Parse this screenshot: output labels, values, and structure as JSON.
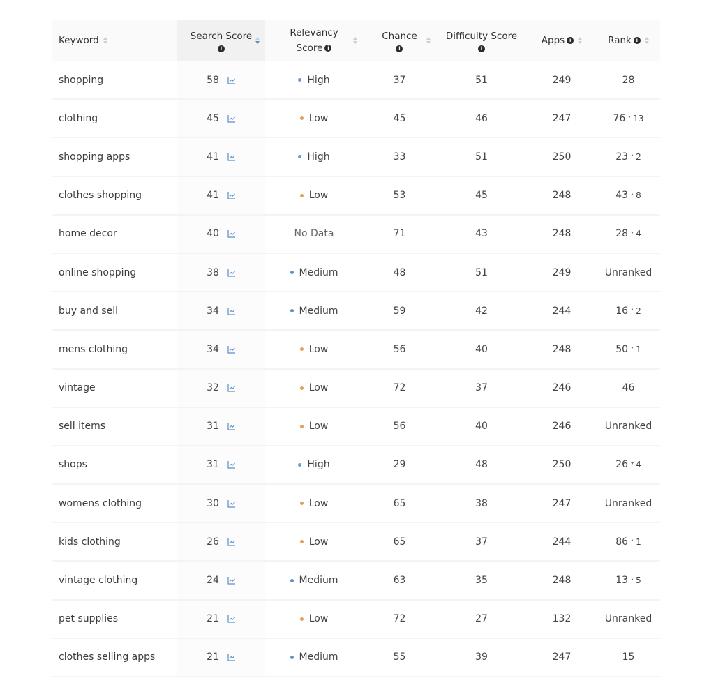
{
  "colors": {
    "high": "#6a9ccc",
    "medium": "#5b93c9",
    "low": "#e0a05a",
    "chart_icon": "#5b8fc4",
    "sort_active": "#5b8fc4"
  },
  "header": {
    "keyword": "Keyword",
    "search_score_line1": "Search Score",
    "relevancy_line1": "Relevancy",
    "relevancy_line2": "Score",
    "chance": "Chance",
    "difficulty": "Difficulty Score",
    "apps": "Apps",
    "rank": "Rank",
    "info_glyph": "i",
    "sorted_column": "Search Score",
    "sort_direction": "descending"
  },
  "rows": [
    {
      "keyword": "shopping",
      "search_score": "58",
      "relevancy": "High",
      "relevancy_level": "high",
      "chance": "37",
      "difficulty": "51",
      "apps": "249",
      "rank": "28",
      "rank_change": "",
      "rank_dir": ""
    },
    {
      "keyword": "clothing",
      "search_score": "45",
      "relevancy": "Low",
      "relevancy_level": "low",
      "chance": "45",
      "difficulty": "46",
      "apps": "247",
      "rank": "76",
      "rank_change": "13",
      "rank_dir": "down"
    },
    {
      "keyword": "shopping apps",
      "search_score": "41",
      "relevancy": "High",
      "relevancy_level": "high",
      "chance": "33",
      "difficulty": "51",
      "apps": "250",
      "rank": "23",
      "rank_change": "2",
      "rank_dir": "up"
    },
    {
      "keyword": "clothes shopping",
      "search_score": "41",
      "relevancy": "Low",
      "relevancy_level": "low",
      "chance": "53",
      "difficulty": "45",
      "apps": "248",
      "rank": "43",
      "rank_change": "8",
      "rank_dir": "up"
    },
    {
      "keyword": "home decor",
      "search_score": "40",
      "relevancy": "No Data",
      "relevancy_level": "none",
      "chance": "71",
      "difficulty": "43",
      "apps": "248",
      "rank": "28",
      "rank_change": "4",
      "rank_dir": "down"
    },
    {
      "keyword": "online shopping",
      "search_score": "38",
      "relevancy": "Medium",
      "relevancy_level": "medium",
      "chance": "48",
      "difficulty": "51",
      "apps": "249",
      "rank": "Unranked",
      "rank_change": "",
      "rank_dir": ""
    },
    {
      "keyword": "buy and sell",
      "search_score": "34",
      "relevancy": "Medium",
      "relevancy_level": "medium",
      "chance": "59",
      "difficulty": "42",
      "apps": "244",
      "rank": "16",
      "rank_change": "2",
      "rank_dir": "up"
    },
    {
      "keyword": "mens clothing",
      "search_score": "34",
      "relevancy": "Low",
      "relevancy_level": "low",
      "chance": "56",
      "difficulty": "40",
      "apps": "248",
      "rank": "50",
      "rank_change": "1",
      "rank_dir": "down"
    },
    {
      "keyword": "vintage",
      "search_score": "32",
      "relevancy": "Low",
      "relevancy_level": "low",
      "chance": "72",
      "difficulty": "37",
      "apps": "246",
      "rank": "46",
      "rank_change": "",
      "rank_dir": ""
    },
    {
      "keyword": "sell items",
      "search_score": "31",
      "relevancy": "Low",
      "relevancy_level": "low",
      "chance": "56",
      "difficulty": "40",
      "apps": "246",
      "rank": "Unranked",
      "rank_change": "",
      "rank_dir": ""
    },
    {
      "keyword": "shops",
      "search_score": "31",
      "relevancy": "High",
      "relevancy_level": "high",
      "chance": "29",
      "difficulty": "48",
      "apps": "250",
      "rank": "26",
      "rank_change": "4",
      "rank_dir": "down"
    },
    {
      "keyword": "womens clothing",
      "search_score": "30",
      "relevancy": "Low",
      "relevancy_level": "low",
      "chance": "65",
      "difficulty": "38",
      "apps": "247",
      "rank": "Unranked",
      "rank_change": "",
      "rank_dir": ""
    },
    {
      "keyword": "kids clothing",
      "search_score": "26",
      "relevancy": "Low",
      "relevancy_level": "low",
      "chance": "65",
      "difficulty": "37",
      "apps": "244",
      "rank": "86",
      "rank_change": "1",
      "rank_dir": "up"
    },
    {
      "keyword": "vintage clothing",
      "search_score": "24",
      "relevancy": "Medium",
      "relevancy_level": "medium",
      "chance": "63",
      "difficulty": "35",
      "apps": "248",
      "rank": "13",
      "rank_change": "5",
      "rank_dir": "up"
    },
    {
      "keyword": "pet supplies",
      "search_score": "21",
      "relevancy": "Low",
      "relevancy_level": "low",
      "chance": "72",
      "difficulty": "27",
      "apps": "132",
      "rank": "Unranked",
      "rank_change": "",
      "rank_dir": ""
    },
    {
      "keyword": "clothes selling apps",
      "search_score": "21",
      "relevancy": "Medium",
      "relevancy_level": "medium",
      "chance": "55",
      "difficulty": "39",
      "apps": "247",
      "rank": "15",
      "rank_change": "",
      "rank_dir": ""
    }
  ]
}
